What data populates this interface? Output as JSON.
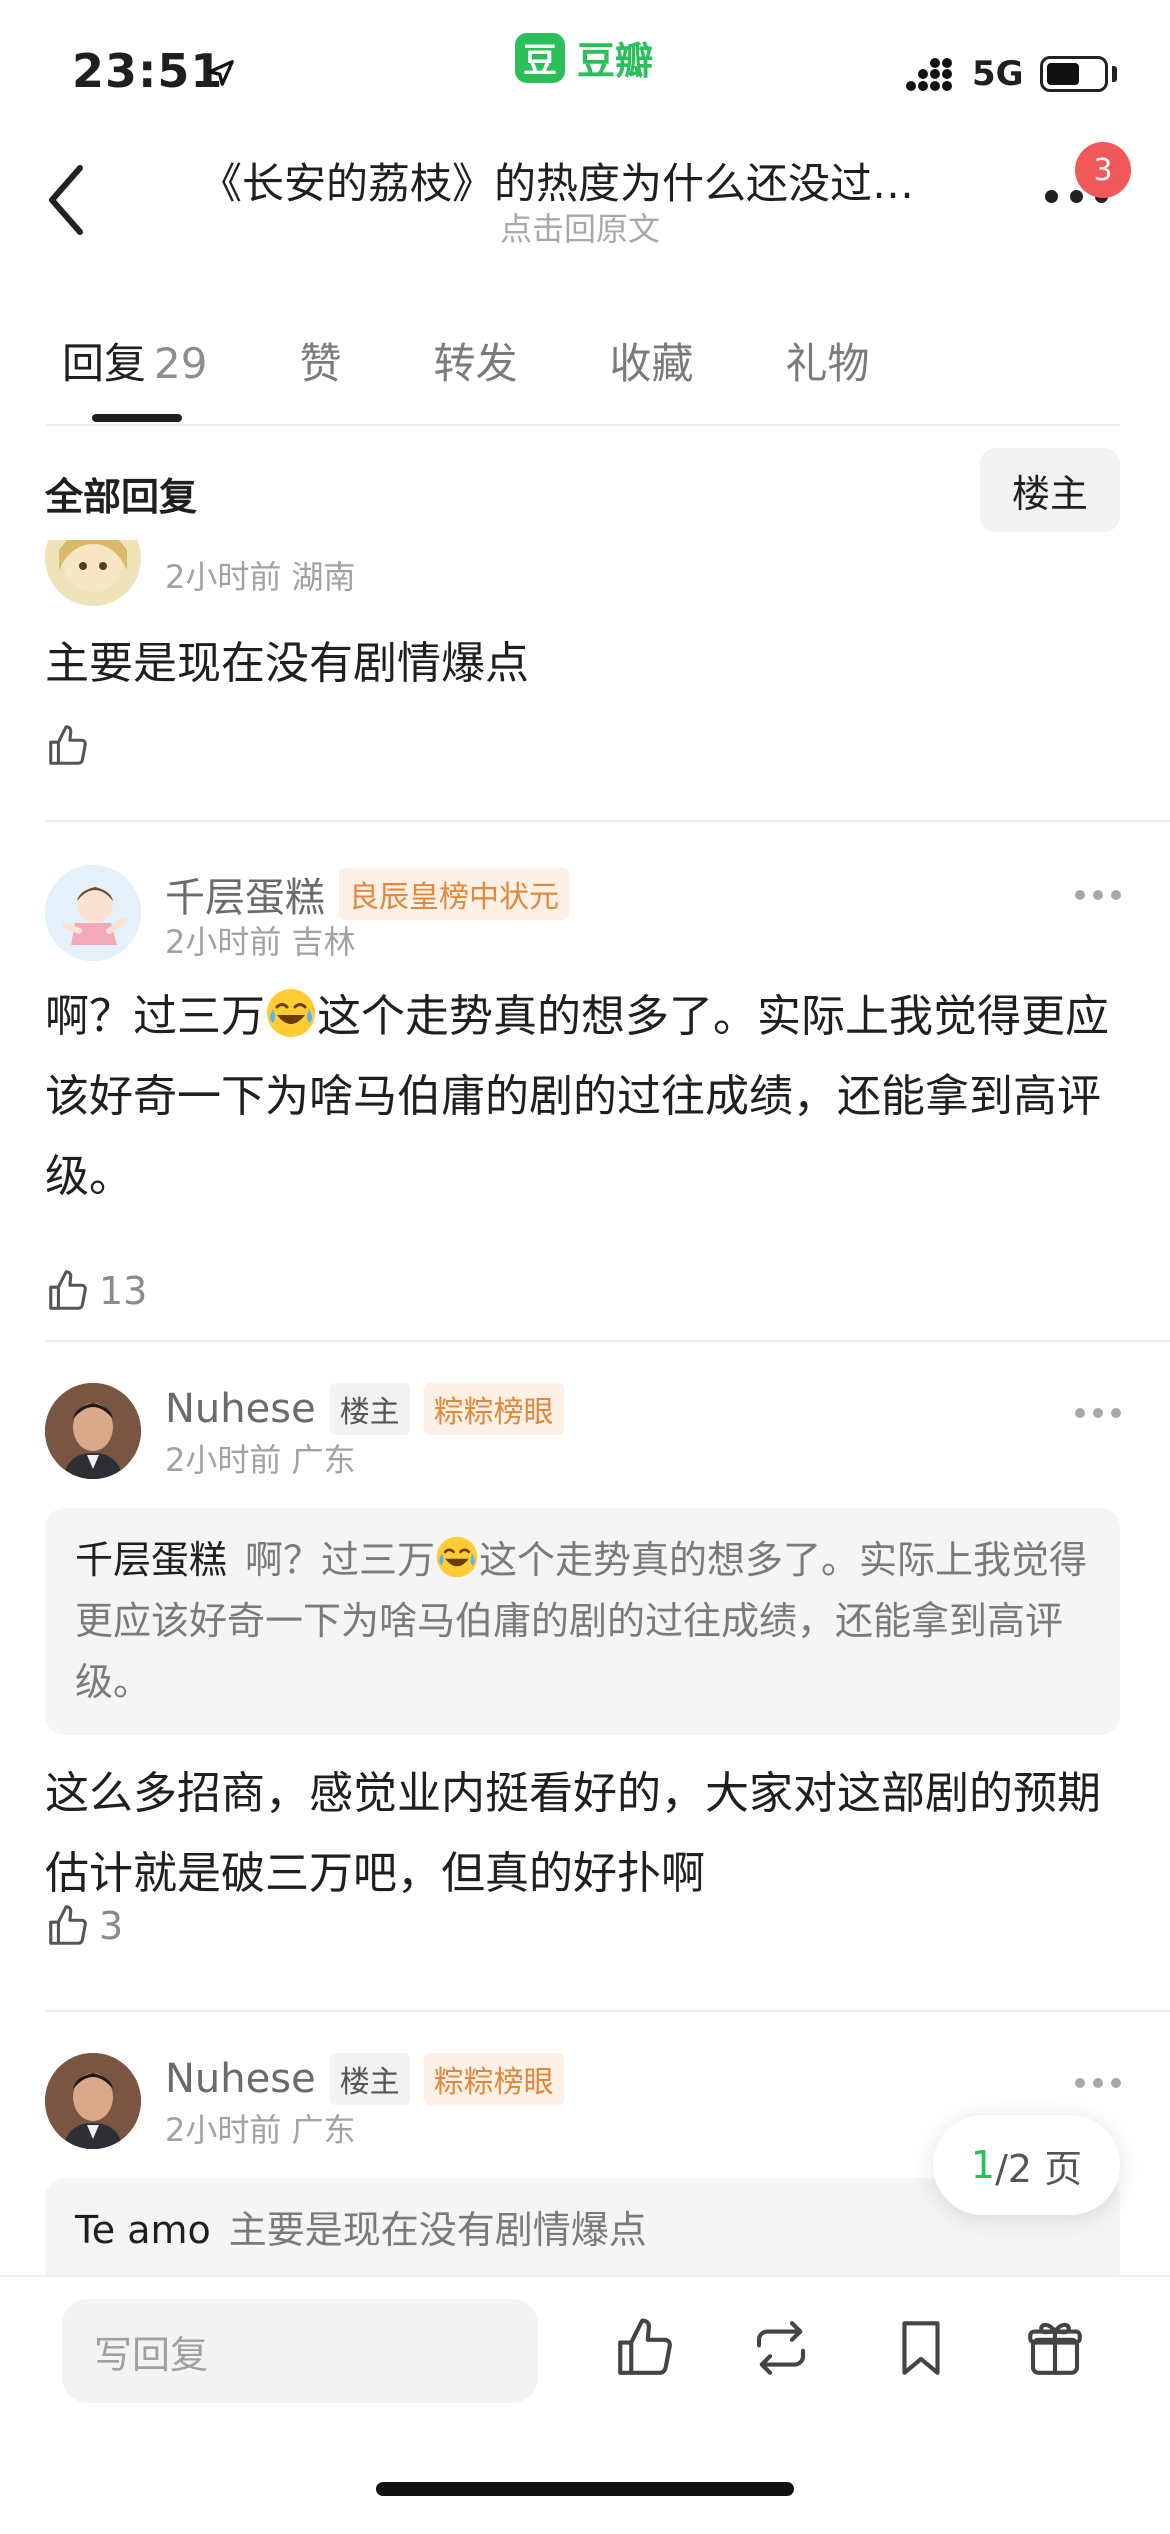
{
  "status_bar": {
    "time": "23:51",
    "network": "5G",
    "battery_level": 0.6
  },
  "app": {
    "logo_char": "豆",
    "name": "豆瓣"
  },
  "header": {
    "title": "《长安的荔枝》的热度为什么还没过…",
    "subtitle": "点击回原文",
    "notification_count": "3"
  },
  "tabs": [
    {
      "label": "回复",
      "count": "29"
    },
    {
      "label": "赞"
    },
    {
      "label": "转发"
    },
    {
      "label": "收藏"
    },
    {
      "label": "礼物"
    }
  ],
  "section": {
    "title": "全部回复",
    "filter_label": "楼主"
  },
  "comments": [
    {
      "meta": "2小时前 湖南",
      "text": "主要是现在没有剧情爆点",
      "likes": ""
    },
    {
      "username": "千层蛋糕",
      "rank_tag": "良辰皇榜中状元",
      "meta": "2小时前 吉林",
      "text_before": "啊？过三万",
      "text_after": "这个走势真的想多了。实际上我觉得更应该好奇一下为啥马伯庸的剧的过往成绩，还能拿到高评级。",
      "likes": "13"
    },
    {
      "username": "Nuhese",
      "op_tag": "楼主",
      "rank_tag": "粽粽榜眼",
      "meta": "2小时前 广东",
      "quote_user": "千层蛋糕",
      "quote_before": "啊？过三万",
      "quote_after": "这个走势真的想多了。实际上我觉得更应该好奇一下为啥马伯庸的剧的过往成绩，还能拿到高评级。",
      "text": "这么多招商，感觉业内挺看好的，大家对这部剧的预期估计就是破三万吧，但真的好扑啊",
      "likes": "3"
    },
    {
      "username": "Nuhese",
      "op_tag": "楼主",
      "rank_tag": "粽粽榜眼",
      "meta": "2小时前 广东",
      "quote_user": "Te amo",
      "quote_text": "主要是现在没有剧情爆点"
    }
  ],
  "pager": {
    "current": "1",
    "total_text": "/2 页"
  },
  "bottom_bar": {
    "reply_placeholder": "写回复"
  },
  "colors": {
    "brand": "#2bbf5a",
    "rank_tag": "#e3883a",
    "badge": "#f1585a"
  }
}
